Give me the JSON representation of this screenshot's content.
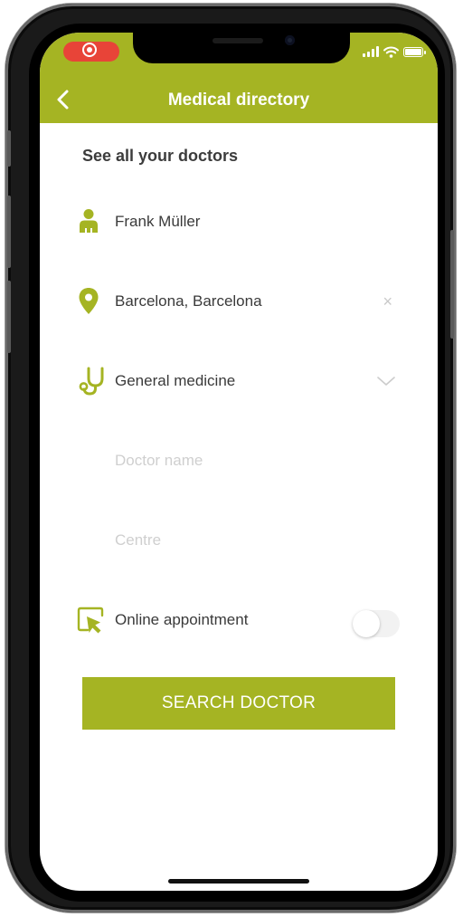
{
  "colors": {
    "accent": "#a5b423",
    "recording": "#e84438"
  },
  "status_bar": {
    "recording_icon": "screen-recording-icon",
    "signal_icon": "signal-bars-icon",
    "wifi_icon": "wifi-icon",
    "battery_icon": "battery-icon"
  },
  "header": {
    "title": "Medical directory",
    "back_icon": "chevron-left-icon"
  },
  "form": {
    "section_title": "See all your doctors",
    "patient": {
      "value": "Frank Müller",
      "icon": "person-icon"
    },
    "location": {
      "value": "Barcelona, Barcelona",
      "icon": "map-pin-icon",
      "clear_label": "×"
    },
    "specialty": {
      "value": "General medicine",
      "icon": "stethoscope-icon",
      "dropdown_icon": "chevron-down-icon"
    },
    "doctor_name": {
      "placeholder": "Doctor name"
    },
    "centre": {
      "placeholder": "Centre"
    },
    "online_appointment": {
      "label": "Online appointment",
      "icon": "cursor-click-icon",
      "enabled": false
    },
    "search_button_label": "SEARCH DOCTOR"
  }
}
